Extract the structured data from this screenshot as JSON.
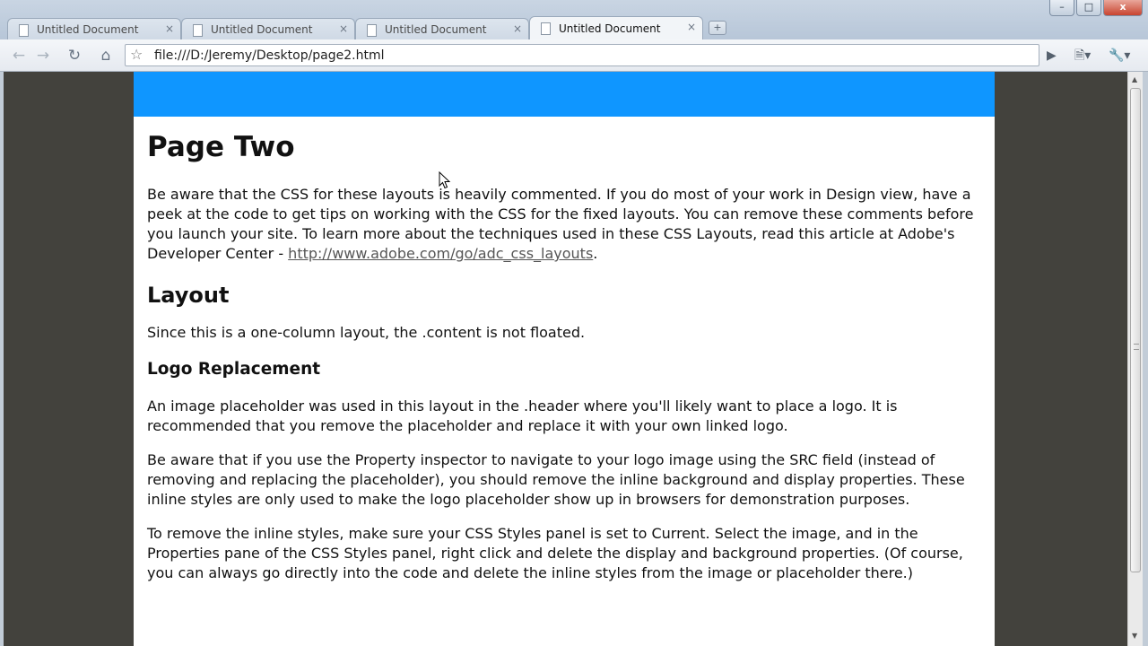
{
  "browser": {
    "tabs": [
      {
        "title": "Untitled Document",
        "active": false
      },
      {
        "title": "Untitled Document",
        "active": false
      },
      {
        "title": "Untitled Document",
        "active": false
      },
      {
        "title": "Untitled Document",
        "active": true
      }
    ],
    "tab_close_glyph": "×",
    "new_tab_glyph": "+",
    "url": "file:///D:/Jeremy/Desktop/page2.html",
    "window_controls": {
      "minimize": "–",
      "maximize": "□",
      "close": "x"
    }
  },
  "colors": {
    "header_band": "#0f96ff",
    "page_background": "#43423d",
    "container_background": "#ffffff"
  },
  "page": {
    "title": "Page Two",
    "intro_text": "Be aware that the CSS for these layouts is heavily commented. If you do most of your work in Design view, have a peek at the code to get tips on working with the CSS for the fixed layouts. You can remove these comments before you launch your site. To learn more about the techniques used in these CSS Layouts, read this article at Adobe's Developer Center - ",
    "intro_link": "http://www.adobe.com/go/adc_css_layouts",
    "intro_end": ".",
    "layout_heading": "Layout",
    "layout_text": "Since this is a one-column layout, the .content is not floated.",
    "logo_heading": "Logo Replacement",
    "logo_para1": "An image placeholder was used in this layout in the .header where you'll likely want to place a logo. It is recommended that you remove the placeholder and replace it with your own linked logo.",
    "logo_para2": "Be aware that if you use the Property inspector to navigate to your logo image using the SRC field (instead of removing and replacing the placeholder), you should remove the inline background and display properties. These inline styles are only used to make the logo placeholder show up in browsers for demonstration purposes.",
    "logo_para3": "To remove the inline styles, make sure your CSS Styles panel is set to Current. Select the image, and in the Properties pane of the CSS Styles panel, right click and delete the display and background properties. (Of course, you can always go directly into the code and delete the inline styles from the image or placeholder there.)"
  }
}
